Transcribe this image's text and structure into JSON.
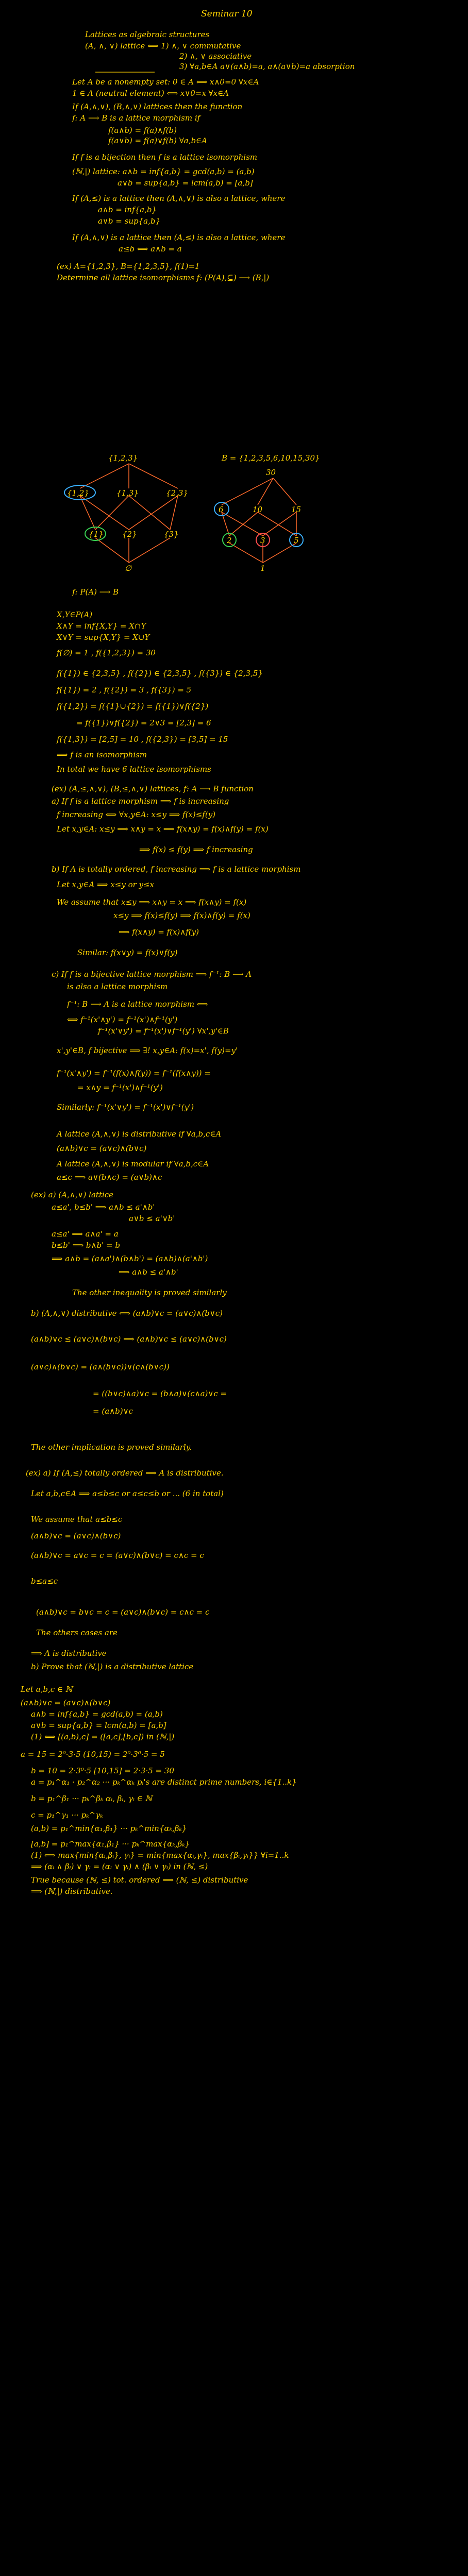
{
  "title": "Seminar 10",
  "lines": [
    "Lattices as algebraic structures",
    "(A, ∧, ∨) lattice ⟺ 1) ∧, ∨ commutative",
    "2) ∧, ∨ associative",
    "3) ∀a,b∈A a∨(a∧b)=a, a∧(a∨b)=a  absorption",
    "Let A be a nonempty set: 0 ∈ A ⟺ x∧0=0 ∀x∈A",
    "1 ∈ A (neutral element) ⟺ x∨0=x ∀x∈A",
    "If (A,∧,∨), (B,∧,∨) lattices then the function",
    "f: A ⟶ B is a lattice morphism if",
    "f(a∧b) = f(a)∧f(b)",
    "f(a∨b) = f(a)∨f(b)   ∀a,b∈A",
    "If f is a bijection then f is a lattice isomorphism",
    "(ℕ,|) lattice: a∧b = inf{a,b} = gcd(a,b) = (a,b)",
    "a∨b = sup{a,b} = lcm(a,b) = [a,b]",
    "If (A,≤) is a lattice then (A,∧,∨) is also a lattice, where",
    "a∧b = inf{a,b}",
    "a∨b = sup{a,b}",
    "If (A,∧,∨) is a lattice then (A,≤) is also a lattice, where",
    "a≤b ⟺ a∧b = a",
    "(ex) A={1,2,3}, B={1,2,3,5}, f(1)=1",
    "Determine all lattice isomorphisms f: (P(A),⊆) ⟶ (B,|)",
    "{1,2,3}",
    "B = {1,2,3,5,6,10,15,30}",
    "30",
    "{1,2}",
    "{1,3}",
    "{2,3}",
    "{1}",
    "{2}",
    "{3}",
    "∅",
    "6",
    "10",
    "15",
    "2",
    "3",
    "5",
    "1",
    "f: P(A) ⟶ B",
    "X,Y∈P(A)",
    "X∧Y = inf{X,Y} = X∩Y",
    "X∨Y = sup{X,Y} = X∪Y",
    "f(∅) = 1 ,  f({1,2,3}) = 30",
    "f({1}) ∈ {2,3,5} ,  f({2}) ∈ {2,3,5} ,  f({3}) ∈ {2,3,5}",
    "f({1}) = 2 ,  f({2}) = 3 ,  f({3}) = 5",
    "f({1,2}) = f({1}∪{2}) = f({1})∨f({2})",
    "= f({1})∨f({2}) = 2∨3 = [2,3] = 6",
    "f({1,3}) = [2,5] = 10 ,  f({2,3}) = [3,5] = 15",
    "⟹ f is an isomorphism",
    "In total we have 6 lattice isomorphisms",
    "(ex) (A,≤,∧,∨), (B,≤,∧,∨) lattices, f: A ⟶ B function",
    "a) If f is a lattice morphism ⟹ f is increasing",
    "f increasing ⟺ ∀x,y∈A: x≤y ⟹ f(x)≤f(y)",
    "Let x,y∈A: x≤y ⟹ x∧y = x ⟹ f(x∧y) = f(x)∧f(y) = f(x)",
    "⟹ f(x) ≤ f(y) ⟹ f increasing",
    "b) If A is totally ordered, f increasing ⟹ f is a lattice morphism",
    "Let x,y∈A ⟹ x≤y or y≤x",
    "We assume that x≤y ⟹ x∧y = x ⟹ f(x∧y) = f(x)",
    "x≤y ⟹ f(x)≤f(y) ⟹ f(x)∧f(y) = f(x)",
    "⟹ f(x∧y) = f(x)∧f(y)",
    "Similar: f(x∨y) = f(x)∨f(y)",
    "c) If f is a bijective lattice morphism ⟹ f⁻¹: B ⟶ A",
    "is also a lattice morphism",
    "f⁻¹: B ⟶ A is a lattice morphism ⟺",
    "⟺ f⁻¹(x'∧y') = f⁻¹(x')∧f⁻¹(y')",
    "f⁻¹(x'∨y') = f⁻¹(x')∨f⁻¹(y')   ∀x',y'∈B",
    "x',y'∈B, f bijective ⟹ ∃! x,y∈A: f(x)=x', f(y)=y'",
    "f⁻¹(x'∧y') = f⁻¹(f(x)∧f(y)) = f⁻¹(f(x∧y)) =",
    "= x∧y = f⁻¹(x')∧f⁻¹(y')",
    "Similarly: f⁻¹(x'∨y') = f⁻¹(x')∨f⁻¹(y')",
    "A lattice (A,∧,∨) is distributive if ∀a,b,c∈A",
    "(a∧b)∨c = (a∨c)∧(b∨c)",
    "A lattice (A,∧,∨) is modular if ∀a,b,c∈A",
    "a≤c ⟹ a∨(b∧c) = (a∨b)∧c",
    "(ex) a) (A,∧,∨) lattice",
    "a≤a', b≤b' ⟹ a∧b ≤ a'∧b'",
    "a∨b ≤ a'∨b'",
    "a≤a' ⟹ a∧a' = a",
    "b≤b' ⟹ b∧b' = b",
    "⟹ a∧b = (a∧a')∧(b∧b') = (a∧b)∧(a'∧b')",
    "⟹ a∧b ≤ a'∧b'",
    "The other inequality is proved similarly",
    "b) (A,∧,∨) distributive ⟺ (a∧b)∨c = (a∨c)∧(b∨c)",
    "(a∧b)∨c ≤ (a∨c)∧(b∨c) ⟹ (a∧b)∨c ≤ (a∨c)∧(b∨c)",
    "(a∨c)∧(b∨c) = (a∧(b∨c))∨(c∧(b∨c))",
    "= ((b∨c)∧a)∨c = (b∧a)∨(c∧a)∨c =",
    "= (a∧b)∨c",
    "The other implication is proved similarly.",
    "(ex) a) If (A,≤) totally ordered ⟹ A is distributive.",
    "Let a,b,c∈A ⟹ a≤b≤c or a≤c≤b or ... (6 in total)",
    "We assume that a≤b≤c",
    "(a∧b)∨c = (a∨c)∧(b∨c)",
    "(a∧b)∨c = a∨c = c   = (a∨c)∧(b∨c) = c∧c = c",
    "b≤a≤c",
    "(a∧b)∨c = b∨c = c = (a∨c)∧(b∨c) = c∧c = c",
    "The others cases are",
    "⟹ A is distributive",
    "b) Prove that (ℕ,|) is a distributive lattice",
    "Let a,b,c ∈ ℕ",
    "(a∧b)∨c = (a∨c)∧(b∨c)",
    "a∧b = inf{a,b} = gcd(a,b) = (a,b)",
    "a∨b = sup{a,b} = lcm(a,b) = [a,b]",
    "(1) ⟺ [(a,b),c] = ([a,c],[b,c])  in (ℕ,|)",
    "a = 15 = 2⁰·3·5   (10,15) = 2⁰·3⁰·5 = 5",
    "b = 10 = 2·3⁰·5   [10,15] = 2·3·5 = 30",
    "a = p₁^α₁ · p₂^α₂ ··· pₖ^αₖ     pᵢ's are distinct prime numbers, i∈{1..k}",
    "b = p₁^β₁ ··· pₖ^βₖ            αᵢ, βᵢ, γᵢ ∈ ℕ",
    "c = p₁^γ₁ ··· pₖ^γₖ",
    "(a,b) = p₁^min{α₁,β₁} ··· pₖ^min{αₖ,βₖ}",
    "[a,b] = p₁^max{α₁,β₁} ··· pₖ^max{αₖ,βₖ}",
    "(1) ⟺ max{min{αᵢ,βᵢ}, γᵢ} = min{max{αᵢ,γᵢ}, max{βᵢ,γᵢ}}  ∀i=1..k",
    "⟹ (αᵢ ∧ βᵢ) ∨ γᵢ = (αᵢ ∨ γᵢ) ∧ (βᵢ ∨ γᵢ)  in (ℕ, ≤)",
    "True because (ℕ, ≤) tot. ordered ⟹ (ℕ, ≤) distributive",
    "⟹ (ℕ,|) distributive."
  ]
}
